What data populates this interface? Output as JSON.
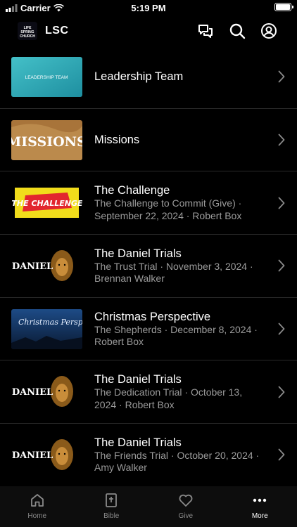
{
  "status": {
    "carrier": "Carrier",
    "time": "5:19 PM"
  },
  "app": {
    "logo_text": "LIFE SPRING CHURCH",
    "name": "LSC",
    "icons": [
      "chat-icon",
      "search-icon",
      "account-icon"
    ]
  },
  "items": [
    {
      "title": "Leadership Team",
      "sub1": "",
      "sub2": "",
      "thumb_text": "LEADERSHIP TEAM",
      "thumb_color": "#2fa7b4"
    },
    {
      "title": "Missions",
      "sub1": "",
      "sub2": "",
      "thumb_text": "MISSIONS",
      "thumb_color": "#b9843e"
    },
    {
      "title": "The Challenge",
      "sub1": "The Challenge to Commit (Give) ·",
      "sub2": "September 22, 2024 · Robert Box",
      "thumb_text": "THE CHALLENGE",
      "thumb_color": "#f1dc1b"
    },
    {
      "title": "The Daniel Trials",
      "sub1": "The Trust Trial · November 3, 2024 ·",
      "sub2": "Brennan Walker",
      "thumb_text": "DANIEL",
      "thumb_color": "#000000"
    },
    {
      "title": "Christmas Perspective",
      "sub1": "The Shepherds · December 8, 2024 ·",
      "sub2": "Robert Box",
      "thumb_text": "Christmas Perspective",
      "thumb_color": "#163a6b"
    },
    {
      "title": "The Daniel Trials",
      "sub1": "The Dedication Trial · October 13,",
      "sub2": "2024 · Robert Box",
      "thumb_text": "DANIEL",
      "thumb_color": "#000000"
    },
    {
      "title": "The Daniel Trials",
      "sub1": "The Friends Trial · October 20, 2024 ·",
      "sub2": "Amy Walker",
      "thumb_text": "DANIEL",
      "thumb_color": "#000000"
    }
  ],
  "tabs": [
    {
      "label": "Home",
      "icon": "home-icon"
    },
    {
      "label": "Bible",
      "icon": "bible-icon"
    },
    {
      "label": "Give",
      "icon": "heart-icon"
    },
    {
      "label": "More",
      "icon": "more-icon",
      "active": true
    }
  ]
}
